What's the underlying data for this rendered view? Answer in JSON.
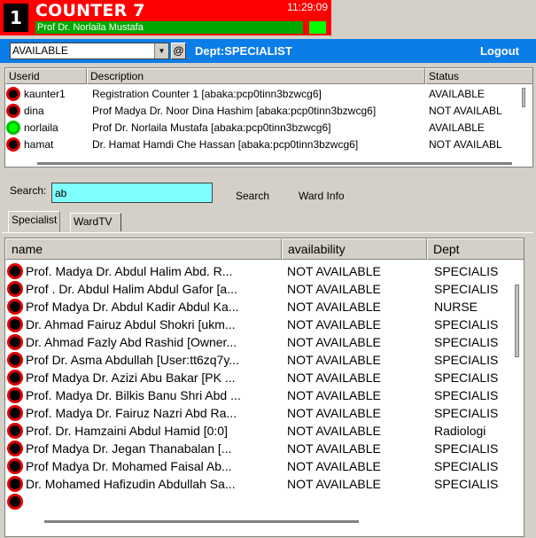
{
  "header": {
    "counter_number": "1",
    "title": "COUNTER 7",
    "clock": "11:29:09",
    "user_name": "Prof Dr. Norlaila Mustafa"
  },
  "toolbar": {
    "status_value": "AVAILABLE",
    "at_label": "@",
    "dept_label": "Dept:SPECIALIST",
    "logout_label": "Logout"
  },
  "users_table": {
    "columns": [
      "Userid",
      "Description",
      "Status"
    ],
    "rows": [
      {
        "userid": "kaunter1",
        "description": "Registration Counter 1 [abaka:pcp0tinn3bzwcg6]",
        "status": "AVAILABLE",
        "icon": "red"
      },
      {
        "userid": "dina",
        "description": "Prof Madya Dr. Noor Dina Hashim [abaka:pcp0tinn3bzwcg6]",
        "status": "NOT AVAILABL",
        "icon": "red"
      },
      {
        "userid": "norlaila",
        "description": "Prof Dr. Norlaila Mustafa [abaka:pcp0tinn3bzwcg6]",
        "status": "AVAILABLE",
        "icon": "green"
      },
      {
        "userid": "hamat",
        "description": "Dr. Hamat Hamdi Che Hassan [abaka:pcp0tinn3bzwcg6]",
        "status": "NOT AVAILABL",
        "icon": "red"
      }
    ]
  },
  "search": {
    "label": "Search:",
    "value": "ab",
    "search_button": "Search",
    "wardinfo_button": "Ward Info"
  },
  "tabs": [
    {
      "label": "Specialist",
      "active": true
    },
    {
      "label": "WardTV",
      "active": false
    }
  ],
  "specialist_table": {
    "columns": [
      "name",
      "availability",
      "Dept"
    ],
    "rows": [
      {
        "name": "Prof. Madya Dr. Abdul Halim Abd. R...",
        "availability": "NOT AVAILABLE",
        "dept": "SPECIALIS"
      },
      {
        "name": "Prof . Dr. Abdul Halim Abdul Gafor [a...",
        "availability": "NOT AVAILABLE",
        "dept": "SPECIALIS"
      },
      {
        "name": "Prof Madya Dr. Abdul Kadir Abdul Ka...",
        "availability": "NOT AVAILABLE",
        "dept": "NURSE"
      },
      {
        "name": "Dr. Ahmad Fairuz Abdul Shokri [ukm...",
        "availability": "NOT AVAILABLE",
        "dept": "SPECIALIS"
      },
      {
        "name": "Dr. Ahmad Fazly Abd Rashid [Owner...",
        "availability": "NOT AVAILABLE",
        "dept": "SPECIALIS"
      },
      {
        "name": "Prof Dr. Asma Abdullah [User:tt6zq7y...",
        "availability": "NOT AVAILABLE",
        "dept": "SPECIALIS"
      },
      {
        "name": "Prof Madya Dr. Azizi Abu Bakar [PK ...",
        "availability": "NOT AVAILABLE",
        "dept": "SPECIALIS"
      },
      {
        "name": "Prof. Madya Dr. Bilkis Banu Shri Abd ...",
        "availability": "NOT AVAILABLE",
        "dept": "SPECIALIS"
      },
      {
        "name": "Prof. Madya Dr. Fairuz Nazri Abd Ra...",
        "availability": "NOT AVAILABLE",
        "dept": "SPECIALIS"
      },
      {
        "name": "Prof. Dr. Hamzaini Abdul Hamid [0:0]",
        "availability": "NOT AVAILABLE",
        "dept": "Radiologi"
      },
      {
        "name": "Prof Madya Dr. Jegan Thanabalan [...",
        "availability": "NOT AVAILABLE",
        "dept": "SPECIALIS"
      },
      {
        "name": "Prof Madya Dr. Mohamed Faisal Ab...",
        "availability": "NOT AVAILABLE",
        "dept": "SPECIALIS"
      },
      {
        "name": "Dr. Mohamed Hafizudin Abdullah Sa...",
        "availability": "NOT AVAILABLE",
        "dept": "SPECIALIS"
      },
      {
        "name": "",
        "availability": "",
        "dept": ""
      }
    ]
  },
  "colors": {
    "header_red": "#ff0000",
    "name_bar_green": "#00a800",
    "toolbar_blue": "#0a7de8",
    "search_cyan": "#80ffff",
    "status_red": "#e00000",
    "status_green": "#00ff00"
  }
}
